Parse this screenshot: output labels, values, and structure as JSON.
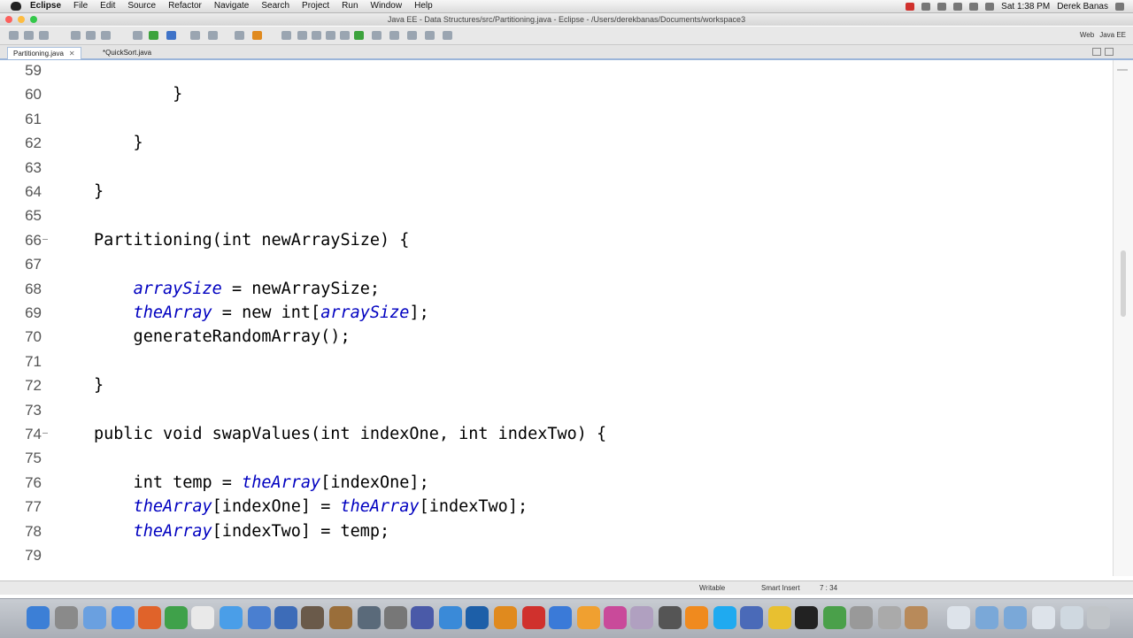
{
  "menubar": {
    "app_name": "Eclipse",
    "items": [
      "File",
      "Edit",
      "Source",
      "Refactor",
      "Navigate",
      "Search",
      "Project",
      "Run",
      "Window",
      "Help"
    ],
    "clock": "Sat 1:38 PM",
    "user": "Derek Banas"
  },
  "window": {
    "title": "Java EE - Data Structures/src/Partitioning.java - Eclipse - /Users/derekbanas/Documents/workspace3"
  },
  "toolbar": {
    "perspective_web": "Web",
    "perspective_javaee": "Java EE"
  },
  "tabs": [
    {
      "label": "Partitioning.java",
      "active": true
    },
    {
      "label": "*QuickSort.java",
      "active": false
    }
  ],
  "editor": {
    "lines": [
      {
        "num": "59",
        "code": ""
      },
      {
        "num": "60",
        "code": "        }"
      },
      {
        "num": "61",
        "code": ""
      },
      {
        "num": "62",
        "code": "    }"
      },
      {
        "num": "63",
        "code": ""
      },
      {
        "num": "64",
        "code": "}"
      },
      {
        "num": "65",
        "code": ""
      },
      {
        "num": "66",
        "code": "Partitioning(int newArraySize) {"
      },
      {
        "num": "67",
        "code": ""
      },
      {
        "num": "68",
        "code": "    arraySize = newArraySize;"
      },
      {
        "num": "69",
        "code": "    theArray = new int[arraySize];"
      },
      {
        "num": "70",
        "code": "    generateRandomArray();"
      },
      {
        "num": "71",
        "code": ""
      },
      {
        "num": "72",
        "code": "}"
      },
      {
        "num": "73",
        "code": ""
      },
      {
        "num": "74",
        "code": "public void swapValues(int indexOne, int indexTwo) {"
      },
      {
        "num": "75",
        "code": ""
      },
      {
        "num": "76",
        "code": "    int temp = theArray[indexOne];"
      },
      {
        "num": "77",
        "code": "    theArray[indexOne] = theArray[indexTwo];"
      },
      {
        "num": "78",
        "code": "    theArray[indexTwo] = temp;"
      },
      {
        "num": "79",
        "code": ""
      }
    ]
  },
  "status": {
    "writable": "Writable",
    "insert_mode": "Smart Insert",
    "position": "7 : 34"
  },
  "colors": {
    "field": "#0000c0",
    "tab_accent": "#9bb5d9"
  }
}
